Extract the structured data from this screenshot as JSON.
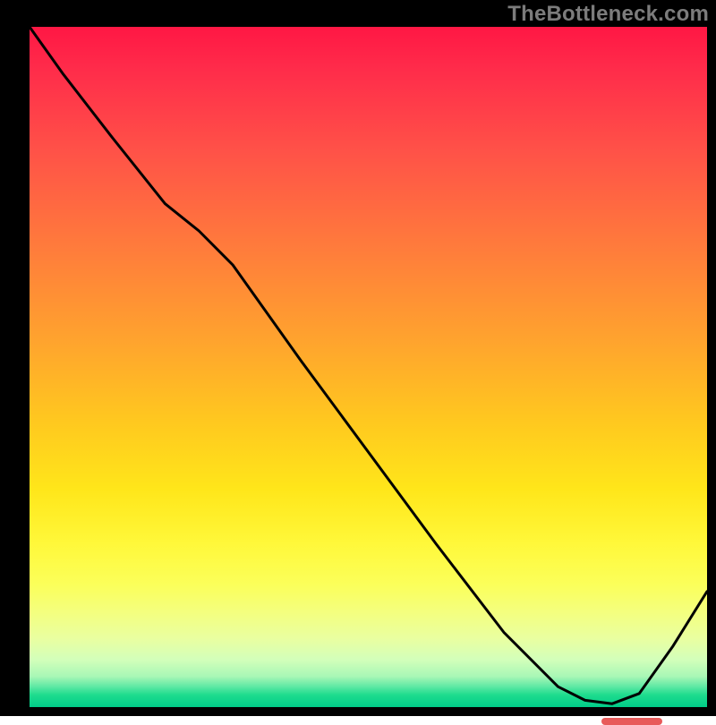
{
  "watermark": "TheBottleneck.com",
  "colors": {
    "frame": "#000000",
    "curve": "#000000",
    "marker": "#e85a5a",
    "gradient_top": "#ff1744",
    "gradient_mid": "#ffe61a",
    "gradient_bottom": "#00cc88"
  },
  "chart_data": {
    "type": "line",
    "title": "",
    "xlabel": "",
    "ylabel": "",
    "xlim": [
      0,
      100
    ],
    "ylim": [
      0,
      100
    ],
    "grid": false,
    "legend": false,
    "annotations": [],
    "series": [
      {
        "name": "curve",
        "x": [
          0,
          5,
          12,
          20,
          25,
          30,
          40,
          50,
          60,
          70,
          78,
          82,
          86,
          90,
          95,
          100
        ],
        "y": [
          100,
          93,
          84,
          74,
          70,
          65,
          51,
          37.5,
          24,
          11,
          3,
          1,
          0.5,
          2,
          9,
          17
        ]
      }
    ],
    "marker_range_x": [
      80,
      89
    ],
    "marker_y": 1.8
  }
}
